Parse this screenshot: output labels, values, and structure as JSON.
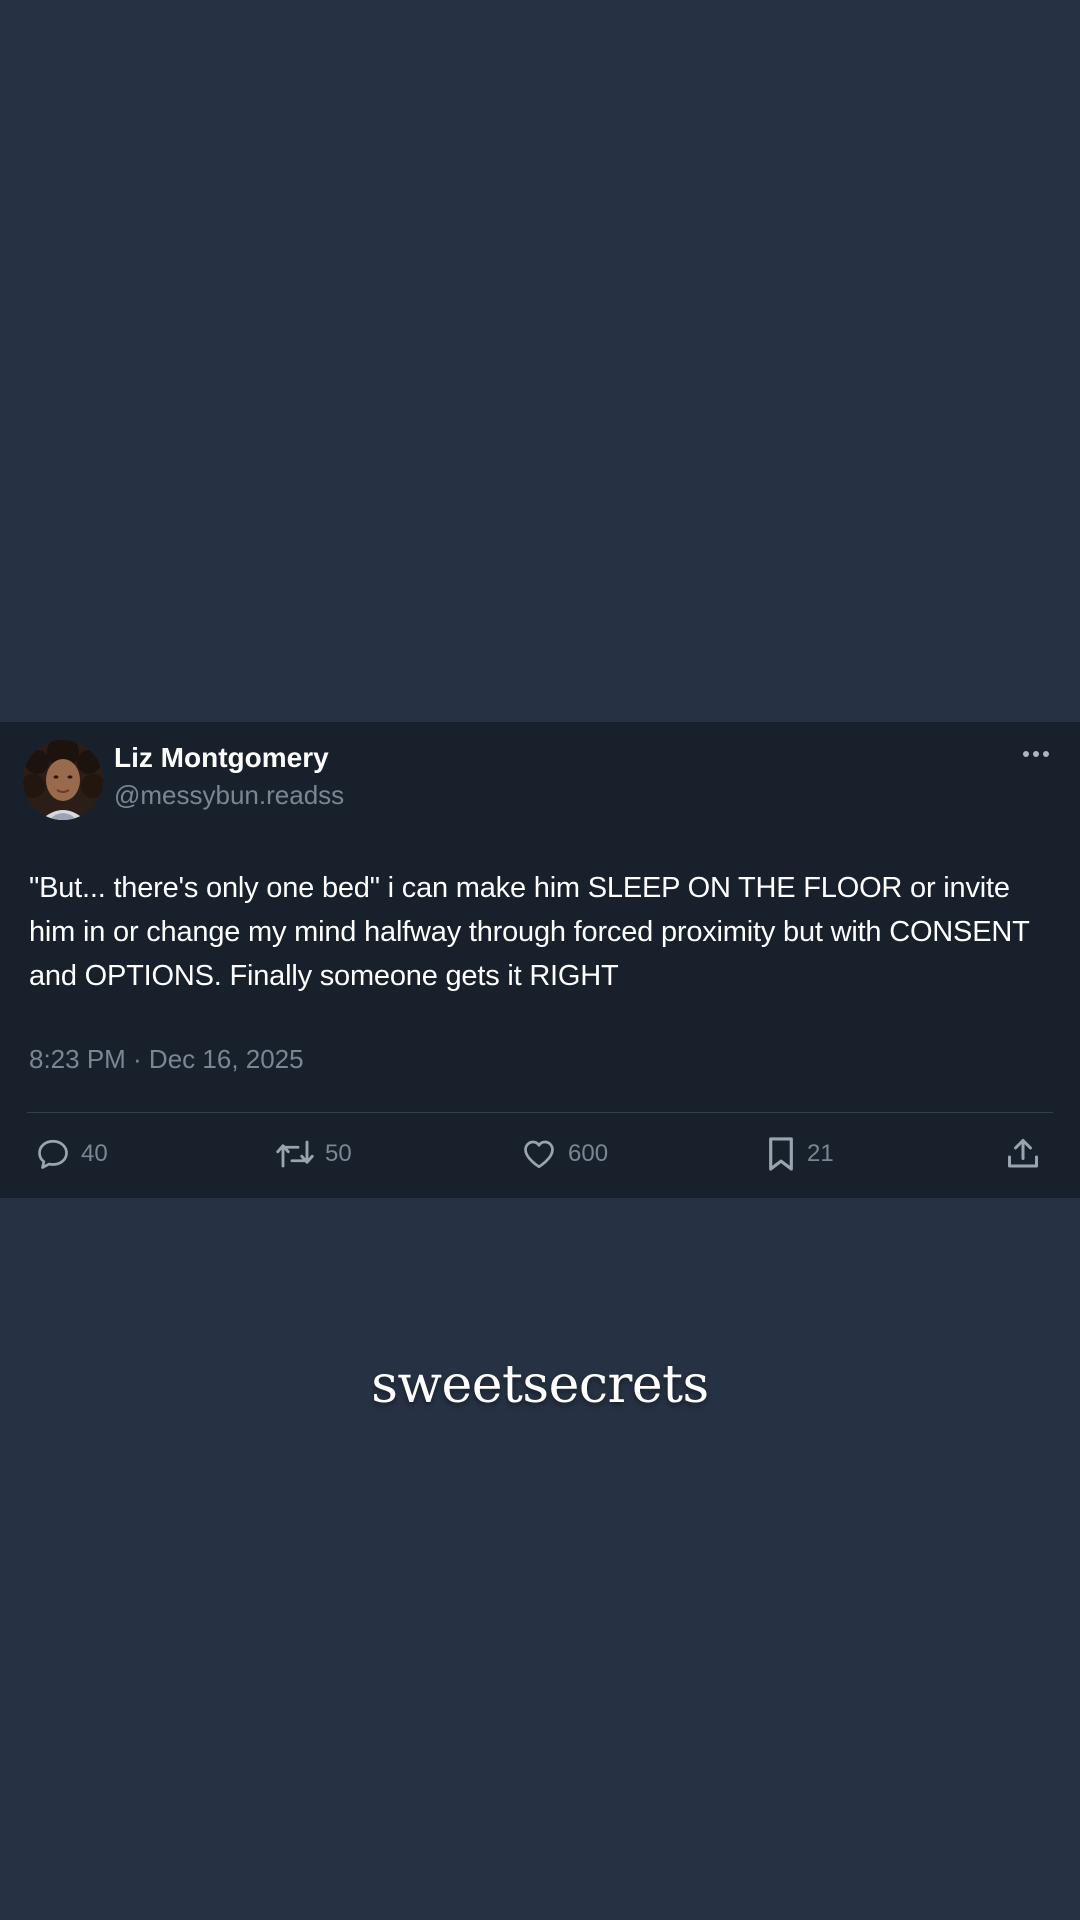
{
  "post": {
    "author": {
      "display_name": "Liz Montgomery",
      "handle": "@messybun.readss"
    },
    "text": "\"But... there's only one bed\" i can make him SLEEP ON THE FLOOR or invite him in or change my mind halfway through forced proximity but with CONSENT and OPTIONS. Finally someone gets it RIGHT",
    "timestamp": "8:23 PM · Dec 16, 2025",
    "actions": {
      "replies": "40",
      "reposts": "50",
      "likes": "600",
      "bookmarks": "21"
    },
    "icons": [
      "more-icon",
      "reply-icon",
      "repost-icon",
      "like-icon",
      "bookmark-icon",
      "share-icon"
    ]
  },
  "watermark": {
    "text": "sweetsecrets"
  },
  "colors": {
    "background": "#263244",
    "card": "#18202b",
    "text_primary": "#ffffff",
    "text_secondary": "#7b8694",
    "divider": "#353f4c"
  }
}
